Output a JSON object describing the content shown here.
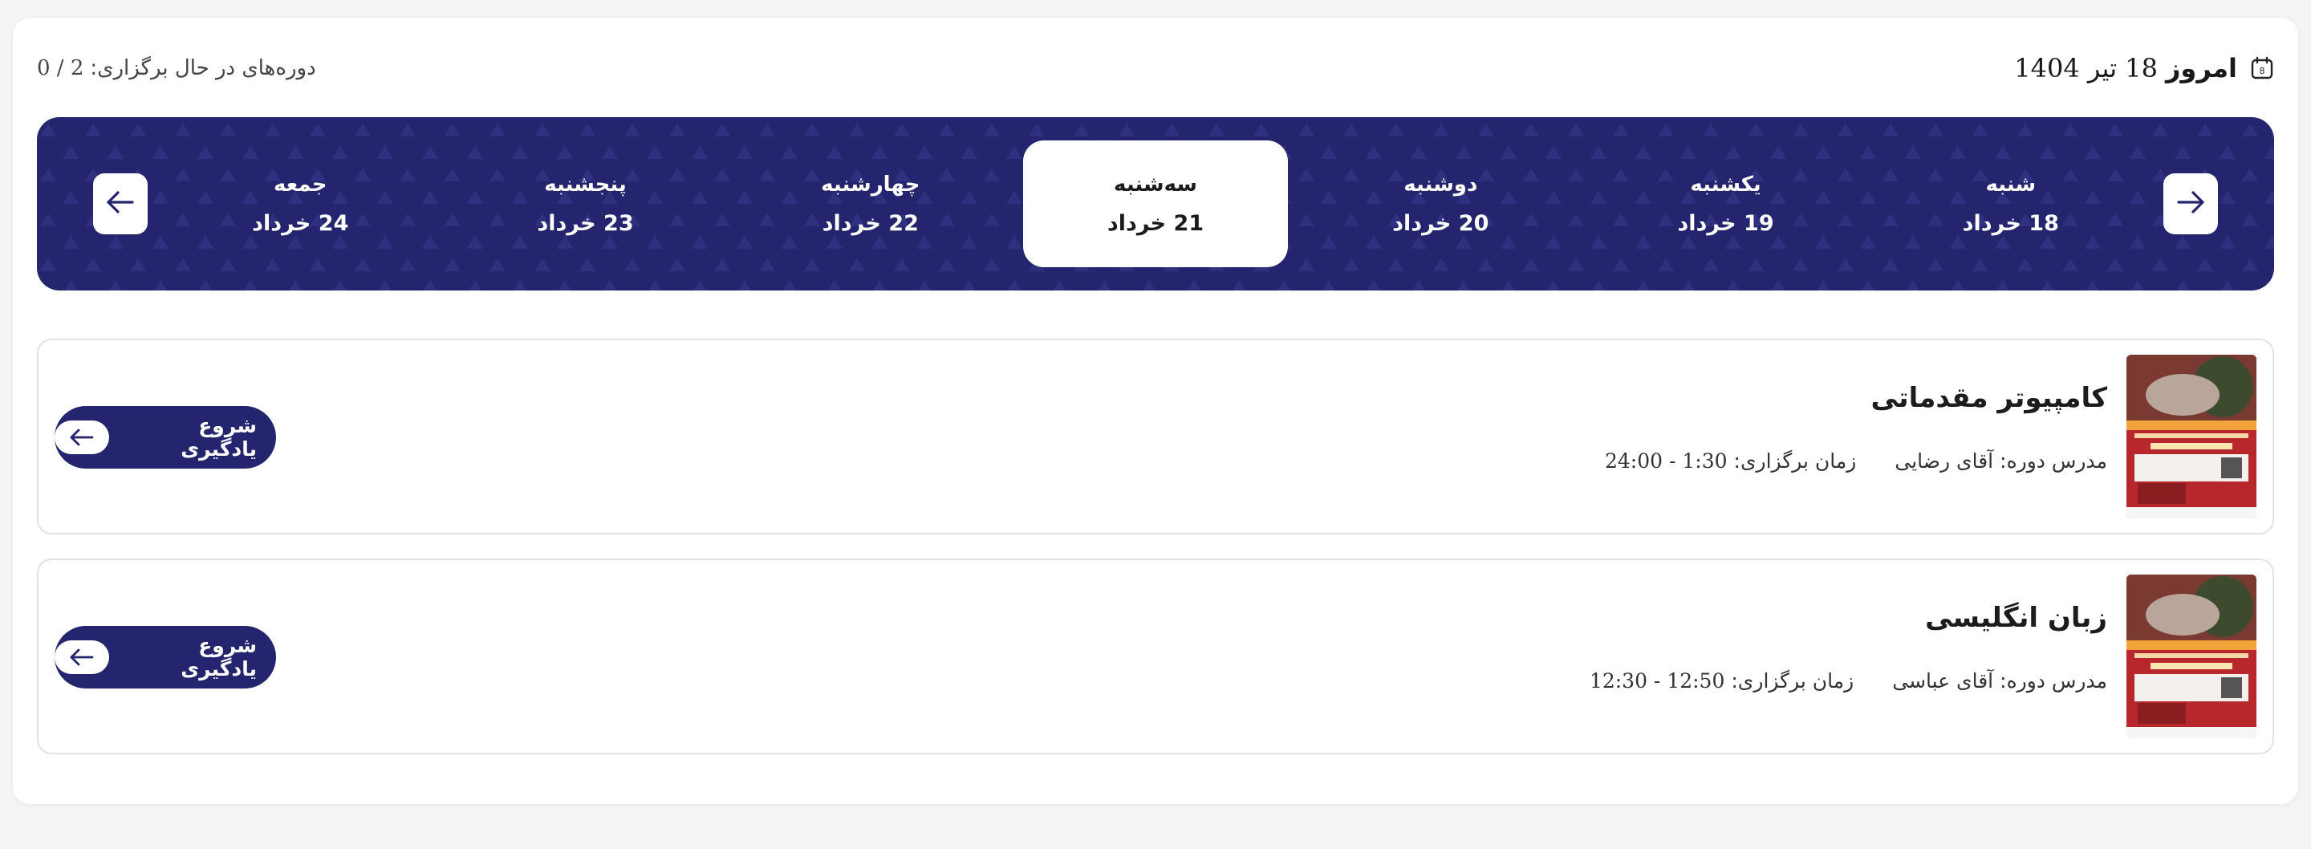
{
  "header": {
    "today_label": "امروز",
    "today_date": "18 تیر 1404",
    "running_label": "دوره‌های در حال برگزاری:",
    "running_count": "0 / 2",
    "calendar_icon_text": "8"
  },
  "days": [
    {
      "name": "شنبه",
      "date": "18 خرداد"
    },
    {
      "name": "یکشنبه",
      "date": "19 خرداد"
    },
    {
      "name": "دوشنبه",
      "date": "20 خرداد"
    },
    {
      "name": "سه‌شنبه",
      "date": "21 خرداد"
    },
    {
      "name": "چهارشنبه",
      "date": "22 خرداد"
    },
    {
      "name": "پنجشنبه",
      "date": "23 خرداد"
    },
    {
      "name": "جمعه",
      "date": "24 خرداد"
    }
  ],
  "active_day": "سه‌شنبه",
  "courses": [
    {
      "title": "کامپیوتر مقدماتی",
      "teacher_label": "مدرس دوره:",
      "teacher": "آقای رضایی",
      "time_label": "زمان برگزاری:",
      "time": "24:00 - 1:30",
      "button": "شروع یادگیری"
    },
    {
      "title": "زبان انگلیسی",
      "teacher_label": "مدرس دوره:",
      "teacher": "آقای عباسی",
      "time_label": "زمان برگزاری:",
      "time": "12:30 - 12:50",
      "button": "شروع یادگیری"
    }
  ],
  "colors": {
    "primary": "#24256e",
    "surface": "#ffffff",
    "thumb_red": "#b8272b"
  },
  "icons": {
    "calendar": "calendar-icon",
    "prev": "arrow-right-icon",
    "next": "arrow-left-icon",
    "start": "arrow-left-icon"
  }
}
